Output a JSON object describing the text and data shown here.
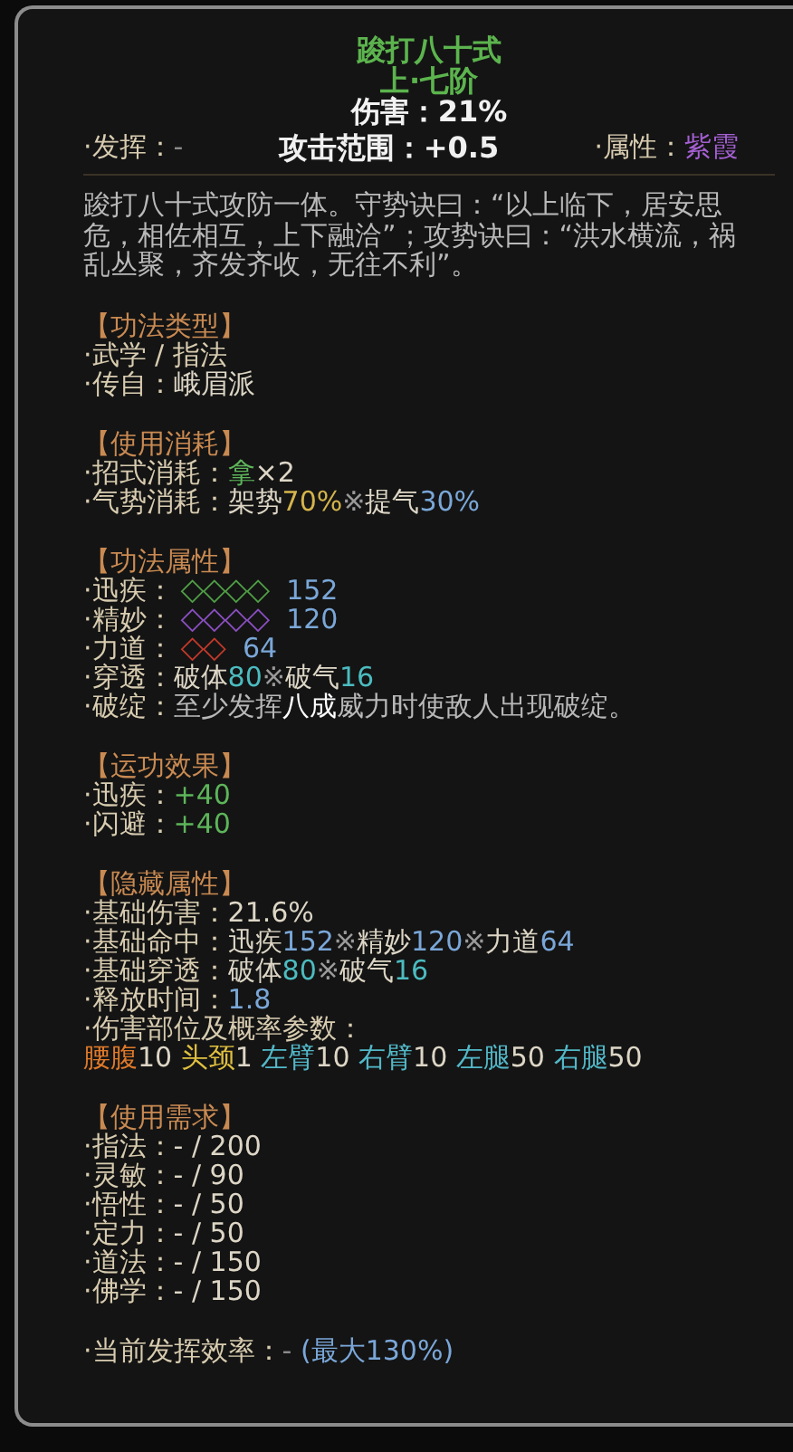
{
  "title": "踆打八十式",
  "rank": "上·七阶",
  "damage": "伤害：21%",
  "stats": [
    {
      "label": "·发挥：",
      "value": "-",
      "color": "#8a8a8a"
    },
    {
      "label": "攻击范围：+0.5",
      "color": "#f0f0f0"
    },
    {
      "label": "·属性：",
      "value": "紫霞",
      "color": "#a45fd2"
    }
  ],
  "description": "踆打八十式攻防一体。守势诀曰：“以上临下，居安思危，相佐相互，上下融洽”；攻势诀曰：“洪水横流，祸乱丛聚，齐发齐收，无往不利”。",
  "sections": [
    {
      "heading": "【功法类型】",
      "lines": [
        {
          "label": "·武学 / 指法"
        },
        {
          "label": "·传自：",
          "parts": [
            {
              "text": "峨眉派"
            }
          ]
        }
      ]
    },
    {
      "heading": "【使用消耗】",
      "lines": [
        {
          "label": "·招式消耗：",
          "parts": [
            {
              "text": "拿",
              "color": "#5db55a"
            },
            {
              "text": "×2"
            }
          ]
        },
        {
          "label": "·气势消耗：",
          "parts": [
            {
              "text": "架势"
            },
            {
              "text": "70%",
              "color": "#d4b44c"
            },
            {
              "text": "※",
              "color": "#9a9a9a"
            },
            {
              "text": "提气"
            },
            {
              "text": "30%",
              "color": "#7aa7d8"
            }
          ]
        }
      ]
    },
    {
      "heading": "【功法属性】",
      "lines": [
        {
          "label": "·迅疾：",
          "kind": "meter",
          "diamonds": "◇◇◇◇",
          "color": "#4f9e45",
          "parts": [
            {
              "text": "152",
              "color": "#7aa7d8"
            }
          ]
        },
        {
          "label": "·精妙：",
          "kind": "meter",
          "diamonds": "◇◇◇◇",
          "color": "#8a4fc0",
          "parts": [
            {
              "text": "120",
              "color": "#7aa7d8"
            }
          ]
        },
        {
          "label": "·力道：",
          "kind": "meter",
          "diamonds": "◇◇",
          "color": "#c0392b",
          "parts": [
            {
              "text": "64",
              "color": "#7aa7d8"
            }
          ]
        },
        {
          "label": "·穿透：",
          "parts": [
            {
              "text": "破体"
            },
            {
              "text": "80",
              "color": "#4cbcc0"
            },
            {
              "text": "※",
              "color": "#9a9a9a"
            },
            {
              "text": "破气"
            },
            {
              "text": "16",
              "color": "#4cbcc0"
            }
          ]
        },
        {
          "label": "·破绽：",
          "parts": [
            {
              "text": "至少发挥",
              "color": "#b8b8b8"
            },
            {
              "text": "八成",
              "color": "#ffffff"
            },
            {
              "text": "威力时使敌人出现破绽。",
              "color": "#b8b8b8"
            }
          ]
        }
      ]
    },
    {
      "heading": "【运功效果】",
      "lines": [
        {
          "label": "·迅疾：",
          "parts": [
            {
              "text": "+40",
              "color": "#5db55a"
            }
          ]
        },
        {
          "label": "·闪避：",
          "parts": [
            {
              "text": "+40",
              "color": "#5db55a"
            }
          ]
        }
      ]
    },
    {
      "heading": "【隐藏属性】",
      "lines": [
        {
          "label": "·基础伤害：",
          "parts": [
            {
              "text": "21.6%"
            }
          ]
        },
        {
          "label": "·基础命中：",
          "parts": [
            {
              "text": "迅疾"
            },
            {
              "text": "152",
              "color": "#7aa7d8"
            },
            {
              "text": "※",
              "color": "#9a9a9a"
            },
            {
              "text": "精妙"
            },
            {
              "text": "120",
              "color": "#7aa7d8"
            },
            {
              "text": "※",
              "color": "#9a9a9a"
            },
            {
              "text": "力道"
            },
            {
              "text": "64",
              "color": "#7aa7d8"
            }
          ]
        },
        {
          "label": "·基础穿透：",
          "parts": [
            {
              "text": "破体"
            },
            {
              "text": "80",
              "color": "#4cbcc0"
            },
            {
              "text": "※",
              "color": "#9a9a9a"
            },
            {
              "text": "破气"
            },
            {
              "text": "16",
              "color": "#4cbcc0"
            }
          ]
        },
        {
          "label": "·释放时间：",
          "parts": [
            {
              "text": "1.8",
              "color": "#7aa7d8"
            }
          ]
        },
        {
          "label": "·伤害部位及概率参数："
        },
        {
          "parts": [
            {
              "text": "腰腹",
              "color": "#e07a2a"
            },
            {
              "text": "10 "
            },
            {
              "text": "头颈",
              "color": "#e0c040"
            },
            {
              "text": "1 "
            },
            {
              "text": "左臂",
              "color": "#52b8c8"
            },
            {
              "text": "10 "
            },
            {
              "text": "右臂",
              "color": "#52b8c8"
            },
            {
              "text": "10 "
            },
            {
              "text": "左腿",
              "color": "#52b8c8"
            },
            {
              "text": "50 "
            },
            {
              "text": "右腿",
              "color": "#52b8c8"
            },
            {
              "text": "50"
            }
          ]
        }
      ]
    },
    {
      "heading": "【使用需求】",
      "lines": [
        {
          "label": "·指法：",
          "parts": [
            {
              "text": "- / 200"
            }
          ]
        },
        {
          "label": "·灵敏：",
          "parts": [
            {
              "text": "- / 90"
            }
          ]
        },
        {
          "label": "·悟性：",
          "parts": [
            {
              "text": "- / 50"
            }
          ]
        },
        {
          "label": "·定力：",
          "parts": [
            {
              "text": "- / 50"
            }
          ]
        },
        {
          "label": "·道法：",
          "parts": [
            {
              "text": "- / 150"
            }
          ]
        },
        {
          "label": "·佛学：",
          "parts": [
            {
              "text": "- / 150"
            }
          ]
        }
      ]
    },
    {
      "lines": [
        {
          "label": "·当前发挥效率：",
          "parts": [
            {
              "text": "- ",
              "color": "#8a8a8a"
            },
            {
              "text": "(最大130%)",
              "color": "#7aa7d8"
            }
          ]
        }
      ]
    }
  ]
}
